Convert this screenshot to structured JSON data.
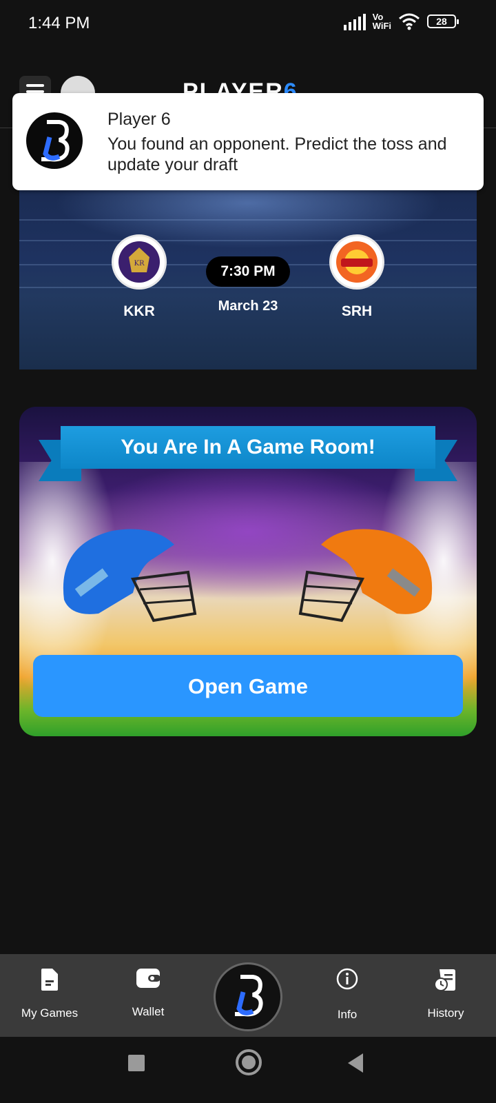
{
  "status_bar": {
    "time": "1:44 PM",
    "network_label_top": "Vo",
    "network_label_bottom": "WiFi",
    "battery": "28"
  },
  "header": {
    "logo_main": "PLAYER",
    "logo_accent": "6"
  },
  "notification": {
    "app_name": "Player 6",
    "message": "You found an opponent. Predict the toss and update your draft"
  },
  "match": {
    "home_team": "KKR",
    "away_team": "SRH",
    "time": "7:30 PM",
    "date": "March 23"
  },
  "game_room": {
    "banner": "You Are In A Game Room!",
    "button_label": "Open Game"
  },
  "bottom_nav": {
    "items": [
      {
        "label": "My Games",
        "icon": "document-icon"
      },
      {
        "label": "Wallet",
        "icon": "wallet-icon"
      },
      {
        "label": "",
        "icon": "app-logo-icon"
      },
      {
        "label": "Info",
        "icon": "info-icon"
      },
      {
        "label": "History",
        "icon": "history-icon"
      }
    ]
  },
  "colors": {
    "accent": "#2a96ff",
    "background": "#121212",
    "nav_bg": "#3a3a3a",
    "ribbon": "#0d86c8"
  }
}
